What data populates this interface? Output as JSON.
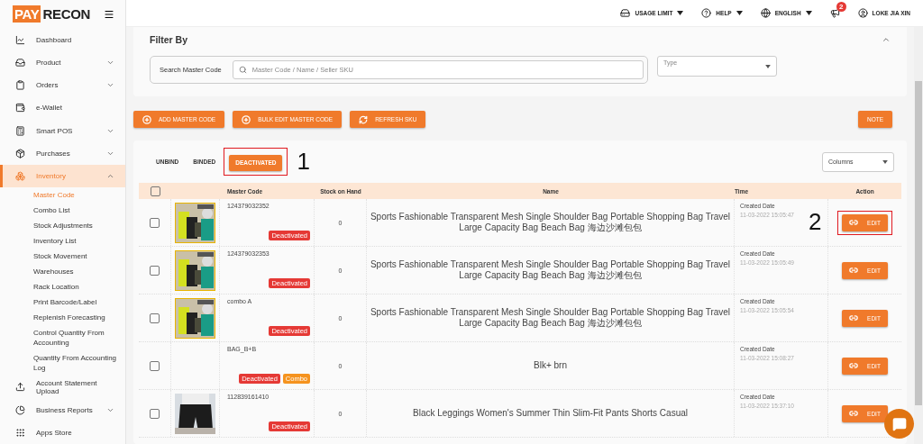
{
  "brand": {
    "part_1": "PAY",
    "part_2": "RECON"
  },
  "topbar": {
    "items": [
      {
        "kind": "usage",
        "label": "USAGE LIMIT"
      },
      {
        "kind": "help",
        "label": "HELP"
      },
      {
        "kind": "language",
        "label": "ENGLISH"
      },
      {
        "kind": "notifications",
        "badge": "2"
      },
      {
        "kind": "user",
        "label": "LOKE JIA XIN"
      }
    ]
  },
  "sidebar": {
    "items": [
      {
        "kind": "chart",
        "label": "Dashboard",
        "selected": false
      },
      {
        "kind": "inbox",
        "label": "Product",
        "selected": false,
        "expanded": false
      },
      {
        "kind": "clipboard",
        "label": "Orders",
        "selected": false,
        "expanded": false
      },
      {
        "kind": "wallet",
        "label": "e-Wallet",
        "selected": false
      },
      {
        "kind": "pos",
        "label": "Smart POS",
        "selected": false,
        "expanded": false
      },
      {
        "kind": "pallet",
        "label": "Purchases",
        "selected": false,
        "expanded": false
      },
      {
        "kind": "boxes",
        "label": "Inventory",
        "selected": true,
        "expanded": true,
        "children": [
          {
            "label": "Master Code",
            "selected": true
          },
          {
            "label": "Combo List",
            "selected": false
          },
          {
            "label": "Stock Adjustments",
            "selected": false
          },
          {
            "label": "Inventory List",
            "selected": false
          },
          {
            "label": "Stock Movement",
            "selected": false
          },
          {
            "label": "Warehouses",
            "selected": false
          },
          {
            "label": "Rack Location",
            "selected": false
          },
          {
            "label": "Print Barcode/Label",
            "selected": false
          },
          {
            "label": "Replenish Forecasting",
            "selected": false
          },
          {
            "label": "Control Quantity From Accounting",
            "selected": false
          },
          {
            "label": "Quantity From Accounting Log",
            "selected": false
          }
        ]
      },
      {
        "kind": "upload",
        "label": "Account Statement Upload",
        "selected": false
      },
      {
        "kind": "pie",
        "label": "Business Reports",
        "selected": false,
        "expanded": false
      },
      {
        "kind": "grid",
        "label": "Apps Store",
        "selected": false
      }
    ]
  },
  "filter": {
    "title": "Filter By",
    "search_label": "Search Master Code",
    "search_placeholder": "Master Code / Name / Seller SKU",
    "type_label": "Type"
  },
  "actions": [
    {
      "kind": "add",
      "label": "ADD MASTER CODE"
    },
    {
      "kind": "add",
      "label": "BULK EDIT MASTER CODE"
    },
    {
      "kind": "refresh",
      "label": "REFRESH SKU"
    }
  ],
  "note_button": "NOTE",
  "tabs": [
    {
      "label": "UNBIND",
      "selected": false
    },
    {
      "label": "BINDED",
      "selected": false
    },
    {
      "label": "DEACTIVATED",
      "selected": true,
      "annotation": "1"
    }
  ],
  "columns_select": "Columns",
  "table": {
    "header_checked": false,
    "columns": [
      "Master Code",
      "Stock on Hand",
      "Name",
      "Time",
      "Action"
    ],
    "rows": [
      {
        "checked": false,
        "image": {
          "kind": "picture"
        },
        "code": "124379032352",
        "badges": [
          {
            "kind": "deactivated",
            "label": "Deactivated"
          }
        ],
        "stock": "0",
        "name": "Sports Fashionable Transparent Mesh Single Shoulder Bag Portable Shopping Bag Travel Large Capacity Bag Beach Bag 海边沙滩包包",
        "time_label": "Created Date",
        "time": "11-03-2022 15:05:47",
        "action": "EDIT",
        "annotation": "2"
      },
      {
        "checked": false,
        "image": {
          "kind": "picture"
        },
        "code": "124379032353",
        "badges": [
          {
            "kind": "deactivated",
            "label": "Deactivated"
          }
        ],
        "stock": "0",
        "name": "Sports Fashionable Transparent Mesh Single Shoulder Bag Portable Shopping Bag Travel Large Capacity Bag Beach Bag 海边沙滩包包",
        "time_label": "Created Date",
        "time": "11-03-2022 15:05:49",
        "action": "EDIT"
      },
      {
        "checked": false,
        "image": {
          "kind": "picture"
        },
        "code": "combo A",
        "badges": [
          {
            "kind": "deactivated",
            "label": "Deactivated"
          }
        ],
        "stock": "0",
        "name": "Sports Fashionable Transparent Mesh Single Shoulder Bag Portable Shopping Bag Travel Large Capacity Bag Beach Bag 海边沙滩包包",
        "time_label": "Created Date",
        "time": "11-03-2022 15:05:54",
        "action": "EDIT"
      },
      {
        "checked": false,
        "code": "BAG_B+B",
        "badges": [
          {
            "kind": "deactivated",
            "label": "Deactivated"
          },
          {
            "kind": "combo",
            "label": "Combo"
          }
        ],
        "stock": "0",
        "name": "Blk+ brn",
        "time_label": "Created Date",
        "time": "11-03-2022 15:08:27",
        "action": "EDIT"
      },
      {
        "checked": false,
        "image": {
          "kind": "picture"
        },
        "code": "112839161410",
        "badges": [
          {
            "kind": "deactivated",
            "label": "Deactivated"
          }
        ],
        "stock": "0",
        "name": "Black Leggings Women's Summer Thin Slim-Fit Pants Shorts Casual",
        "time_label": "Created Date",
        "time": "11-03-2022 15:37:10",
        "action": "EDIT"
      }
    ]
  }
}
